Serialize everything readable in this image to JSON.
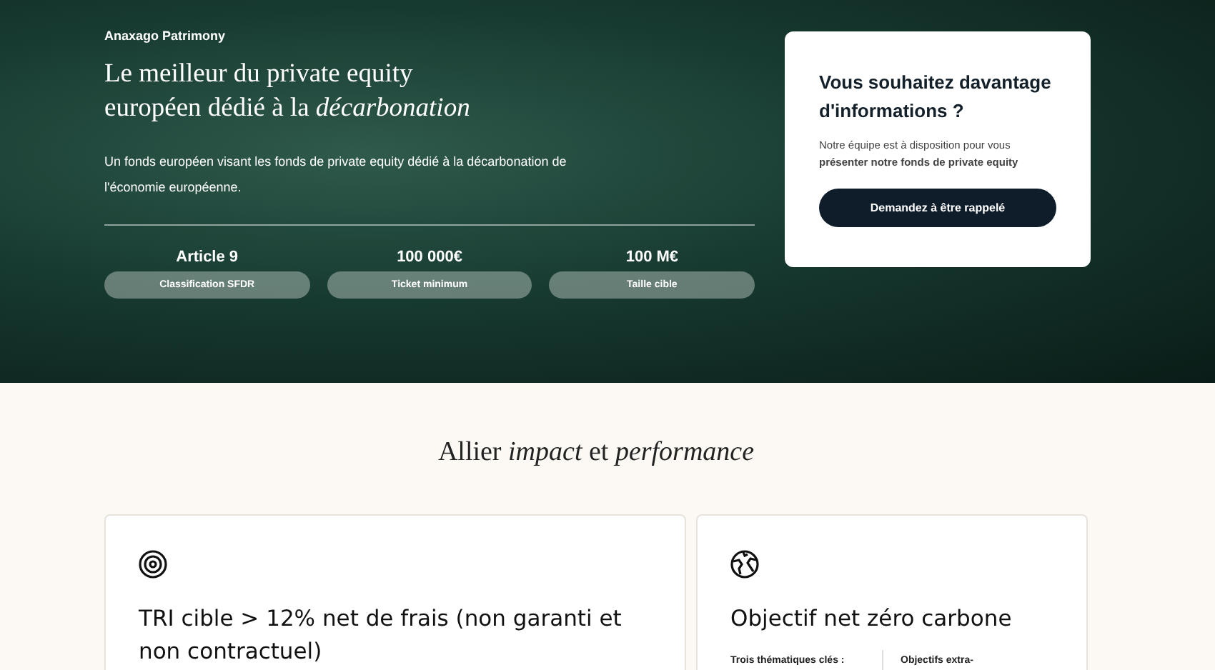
{
  "hero": {
    "brand": "Anaxago Patrimony",
    "title": "Le meilleur du private equity européen dédié à la *décarbonation*",
    "description": "Un fonds européen visant les fonds de private equity dédié à la décarbonation de l'économie européenne.",
    "stats": [
      {
        "value": "Article 9",
        "label": "Classification SFDR"
      },
      {
        "value": "100 000€",
        "label": "Ticket minimum"
      },
      {
        "value": "100 M€",
        "label": "Taille cible"
      }
    ]
  },
  "contact_card": {
    "title": "Vous souhaitez davantage d'informations ?",
    "text": "Notre équipe est à disposition pour vous **présenter notre fonds de private equity**",
    "button": "Demandez à être rappelé"
  },
  "section": {
    "heading": "Allier *impact* et *performance*",
    "cards": [
      {
        "kind": "target",
        "title": "TRI cible > 12% net de frais (non garanti et non contractuel)"
      },
      {
        "kind": "globe",
        "title": "Objectif net zéro carbone",
        "columns": [
          "Trois thématiques clés :",
          "Objectifs extra-"
        ]
      }
    ]
  }
}
